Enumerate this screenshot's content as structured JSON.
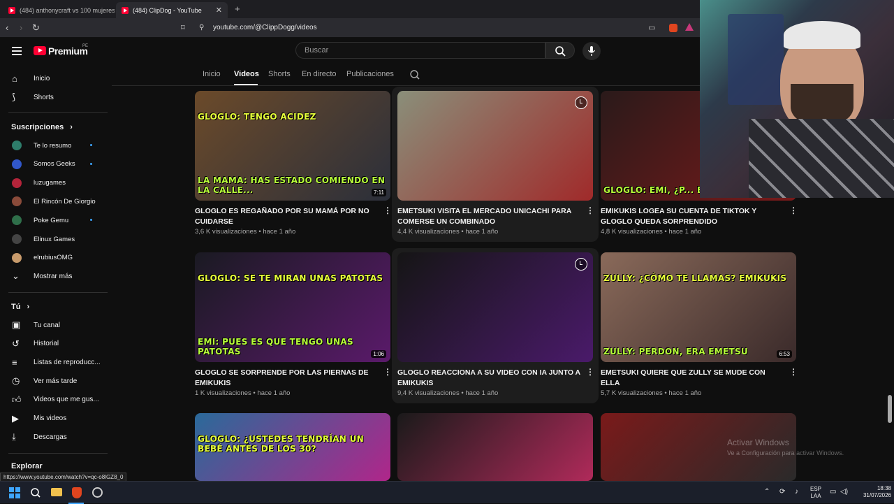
{
  "browser": {
    "tabs": [
      {
        "title": "(484) anthonycraft vs 100 mujeres - Y",
        "active": false
      },
      {
        "title": "(484) ClipDog - YouTube",
        "active": true
      }
    ],
    "new_tab": "+",
    "url": "youtube.com/@ClippDogg/videos",
    "status_url": "https://www.youtube.com/watch?v=qc-o8lGZ8_0"
  },
  "masthead": {
    "logo_text": "Premium",
    "logo_badge": "PE",
    "search_placeholder": "Buscar"
  },
  "sidebar": {
    "main": [
      {
        "label": "Inicio",
        "icon": "home-icon"
      },
      {
        "label": "Shorts",
        "icon": "shorts-icon"
      }
    ],
    "subscriptions_header": "Suscripciones",
    "subscriptions": [
      {
        "label": "Te lo resumo",
        "color": "#2e7d6b",
        "dot": true
      },
      {
        "label": "Somos Geeks",
        "color": "#3157c9",
        "dot": true
      },
      {
        "label": "luzugames",
        "color": "#b3243a",
        "dot": false
      },
      {
        "label": "El Rincón De Giorgio",
        "color": "#8a4b3a",
        "dot": false
      },
      {
        "label": "Poke Gemu",
        "color": "#2f6f4a",
        "dot": true
      },
      {
        "label": "Elinux Games",
        "color": "#444444",
        "dot": false
      },
      {
        "label": "elrubiusOMG",
        "color": "#c79a6b",
        "dot": false
      }
    ],
    "show_more": "Mostrar más",
    "you_header": "Tú",
    "you_items": [
      {
        "label": "Tu canal",
        "icon": "channel-icon"
      },
      {
        "label": "Historial",
        "icon": "history-icon"
      },
      {
        "label": "Listas de reproducc...",
        "icon": "playlist-icon"
      },
      {
        "label": "Ver más tarde",
        "icon": "watch-later-icon"
      },
      {
        "label": "Videos que me gus...",
        "icon": "like-icon"
      },
      {
        "label": "Mis videos",
        "icon": "my-videos-icon"
      },
      {
        "label": "Descargas",
        "icon": "download-icon"
      }
    ],
    "explore_header": "Explorar"
  },
  "channel_tabs": [
    "Inicio",
    "Videos",
    "Shorts",
    "En directo",
    "Publicaciones"
  ],
  "active_tab": "Videos",
  "videos": [
    {
      "title": "GLOGLO ES REGAÑADO POR SU MAMÁ POR NO CUIDARSE",
      "views": "3,6 K visualizaciones",
      "age": "hace 1 año",
      "duration": "7:11",
      "banner": "GLOGLO: TENGO ACIDEZ",
      "banner2": "LA MAMA: HAS ESTADO COMIENDO EN LA CALLE...",
      "bg": "#6b4a2a",
      "bg2": "#2b2f3a"
    },
    {
      "title": "EMETSUKI VISITA EL MERCADO UNICACHI PARA COMERSE UN COMBINADO",
      "views": "4,4 K visualizaciones",
      "age": "hace 1 año",
      "duration": "",
      "banner": "",
      "banner2": "",
      "bg": "#8a8f7a",
      "bg2": "#a02a2a"
    },
    {
      "title": "EMIKUKIS LOGEA SU CUENTA DE TIKTOK Y GLOGLO QUEDA SORPRENDIDO",
      "views": "4,8 K visualizaciones",
      "age": "hace 1 año",
      "duration": "",
      "banner": "",
      "banner2": "GLOGLO: EMI, ¿P... ESTAS C...",
      "bg": "#2a1a1a",
      "bg2": "#7a1a1a"
    },
    {
      "title": "GLOGLO SE SORPRENDE POR LAS PIERNAS DE EMIKUKIS",
      "views": "1 K visualizaciones",
      "age": "hace 1 año",
      "duration": "1:06",
      "banner": "GLOGLO: SE TE MIRAN UNAS PATOTAS",
      "banner2": "EMI: PUES ES QUE TENGO UNAS PATOTAS",
      "bg": "#1a1a22",
      "bg2": "#5a1a6a"
    },
    {
      "title": "GLOGLO REACCIONA A SU VIDEO CON IA JUNTO A EMIKUKIS",
      "views": "9,4 K visualizaciones",
      "age": "hace 1 año",
      "duration": "",
      "banner": "",
      "banner2": "",
      "bg": "#151515",
      "bg2": "#4a1a6a"
    },
    {
      "title": "EMETSUKI QUIERE QUE ZULLY SE MUDE CON ELLA",
      "views": "5,7 K visualizaciones",
      "age": "hace 1 año",
      "duration": "6:53",
      "banner": "ZULLY: ¿CÓMO TE LLAMAS? EMIKUKIS",
      "banner2": "ZULLY: PERDON, ERA EMETSU",
      "bg": "#8a6a5a",
      "bg2": "#3a2a2a"
    },
    {
      "title": "",
      "views": "",
      "age": "",
      "duration": "",
      "banner": "GLOGLO: ¿USTEDES TENDRÍAN UN BEBÉ ANTES DE LOS 30?",
      "banner2": "",
      "bg": "#2a6a9a",
      "bg2": "#b0268a"
    },
    {
      "title": "",
      "views": "",
      "age": "",
      "duration": "",
      "banner": "",
      "banner2": "",
      "bg": "#1a1a1a",
      "bg2": "#b02a5a"
    },
    {
      "title": "",
      "views": "",
      "age": "",
      "duration": "",
      "banner": "",
      "banner2": "",
      "bg": "#7a1a1a",
      "bg2": "#2a2a2a"
    }
  ],
  "watermark": {
    "title": "Activar Windows",
    "subtitle": "Ve a Configuración para activar Windows."
  },
  "taskbar": {
    "lang1": "ESP",
    "lang2": "LAA",
    "time": "18:38",
    "date": "31/07/2026"
  }
}
